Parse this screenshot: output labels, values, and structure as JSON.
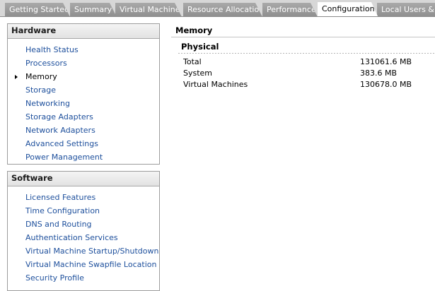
{
  "tabs": [
    {
      "label": "Getting Started"
    },
    {
      "label": "Summary"
    },
    {
      "label": "Virtual Machines"
    },
    {
      "label": "Resource Allocation"
    },
    {
      "label": "Performance"
    },
    {
      "label": "Configuration"
    },
    {
      "label": "Local Users & Gr"
    }
  ],
  "active_tab": "Configuration",
  "hardware": {
    "header": "Hardware",
    "items": [
      {
        "label": "Health Status"
      },
      {
        "label": "Processors"
      },
      {
        "label": "Memory"
      },
      {
        "label": "Storage"
      },
      {
        "label": "Networking"
      },
      {
        "label": "Storage Adapters"
      },
      {
        "label": "Network Adapters"
      },
      {
        "label": "Advanced Settings"
      },
      {
        "label": "Power Management"
      }
    ],
    "selected": "Memory"
  },
  "software": {
    "header": "Software",
    "items": [
      {
        "label": "Licensed Features"
      },
      {
        "label": "Time Configuration"
      },
      {
        "label": "DNS and Routing"
      },
      {
        "label": "Authentication Services"
      },
      {
        "label": "Virtual Machine Startup/Shutdown"
      },
      {
        "label": "Virtual Machine Swapfile Location"
      },
      {
        "label": "Security Profile"
      }
    ]
  },
  "content": {
    "title": "Memory",
    "section": "Physical",
    "rows": [
      {
        "label": "Total",
        "value": "131061.6 MB"
      },
      {
        "label": "System",
        "value": "383.6 MB"
      },
      {
        "label": "Virtual Machines",
        "value": "130678.0 MB"
      }
    ]
  }
}
